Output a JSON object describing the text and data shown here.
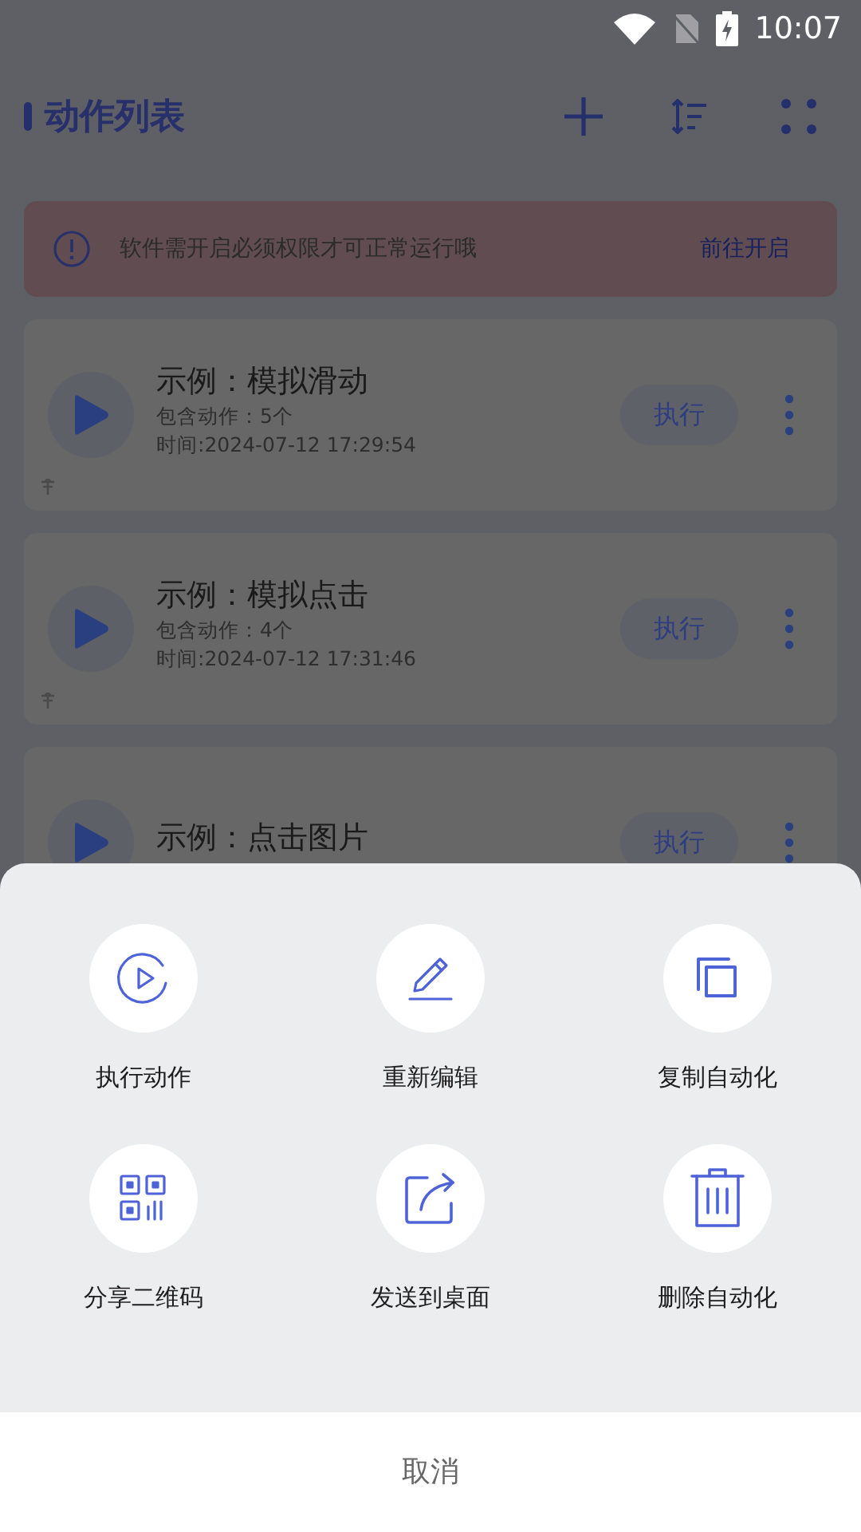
{
  "status_bar": {
    "time": "10:07"
  },
  "header": {
    "title": "动作列表"
  },
  "banner": {
    "message": "软件需开启必须权限才可正常运行哦",
    "action": "前往开启"
  },
  "cards": [
    {
      "title": "示例：模拟滑动",
      "count": "包含动作：5个",
      "time": "时间:2024-07-12 17:29:54",
      "button": "执行"
    },
    {
      "title": "示例：模拟点击",
      "count": "包含动作：4个",
      "time": "时间:2024-07-12 17:31:46",
      "button": "执行"
    },
    {
      "title": "示例：点击图片",
      "button": "执行"
    }
  ],
  "sheet": {
    "actions": [
      {
        "kind": "play",
        "label": "执行动作"
      },
      {
        "kind": "edit",
        "label": "重新编辑"
      },
      {
        "kind": "copy",
        "label": "复制自动化"
      },
      {
        "kind": "qr",
        "label": "分享二维码"
      },
      {
        "kind": "share",
        "label": "发送到桌面"
      },
      {
        "kind": "trash",
        "label": "删除自动化"
      }
    ],
    "cancel": "取消"
  }
}
